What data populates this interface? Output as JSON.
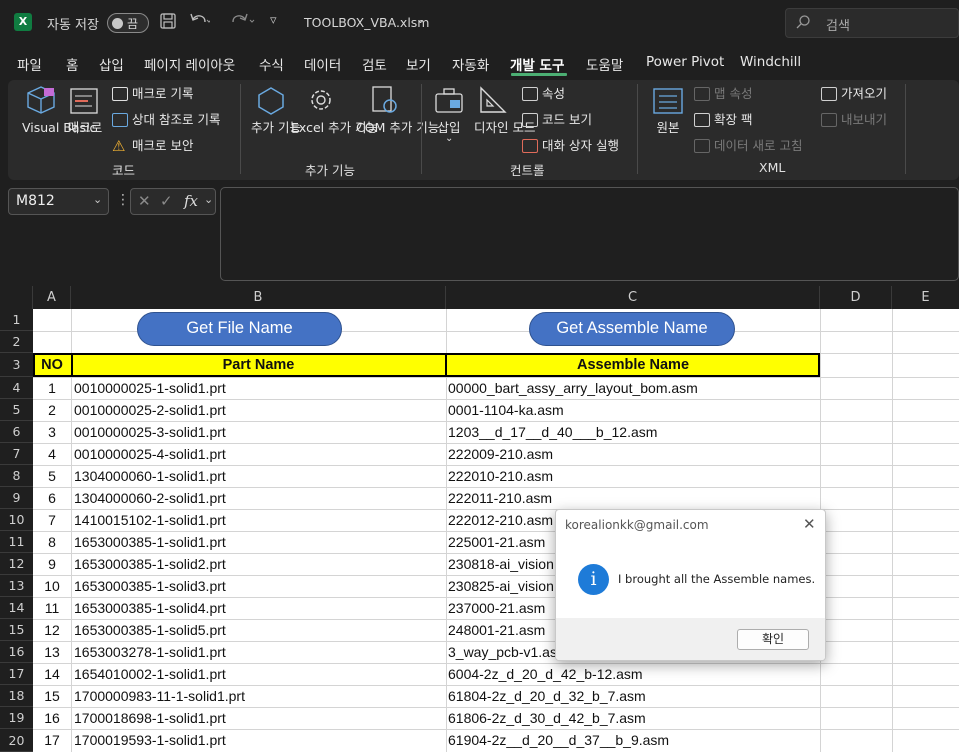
{
  "titlebar": {
    "autosave_label": "자동 저장",
    "autosave_state": "끔",
    "filename": "TOOLBOX_VBA.xlsm",
    "search_placeholder": "검색"
  },
  "tabs": [
    "파일",
    "홈",
    "삽입",
    "페이지 레이아웃",
    "수식",
    "데이터",
    "검토",
    "보기",
    "자동화",
    "개발 도구",
    "도움말",
    "Power Pivot",
    "Windchill"
  ],
  "active_tab": "개발 도구",
  "ribbon": {
    "code": {
      "visual_basic": "Visual Basic",
      "macros": "매크로",
      "record_macro": "매크로 기록",
      "relative_ref": "상대 참조로 기록",
      "macro_security": "매크로 보안",
      "group_label": "코드"
    },
    "addins": {
      "addins": "추가 기능",
      "excel_addins": "Excel 추가 기능",
      "com_addins": "COM 추가 기능",
      "group_label": "추가 기능"
    },
    "controls": {
      "insert": "삽입",
      "design_mode": "디자인 모드",
      "properties": "속성",
      "view_code": "코드 보기",
      "run_dialog": "대화 상자 실행",
      "group_label": "컨트롤"
    },
    "xml": {
      "source": "원본",
      "map_properties": "맵 속성",
      "expansion_packs": "확장 팩",
      "refresh_data": "데이터 새로 고침",
      "import": "가져오기",
      "export": "내보내기",
      "group_label": "XML"
    }
  },
  "formula_bar": {
    "name_box": "M812",
    "fx": "fx"
  },
  "sheet": {
    "columns": [
      "A",
      "B",
      "C",
      "D",
      "E"
    ],
    "row_numbers": [
      "1",
      "2",
      "3",
      "4",
      "5",
      "6",
      "7",
      "8",
      "9",
      "10",
      "11",
      "12",
      "13",
      "14",
      "15",
      "16",
      "17",
      "18",
      "19",
      "20"
    ],
    "button_file": "Get File Name",
    "button_assemble": "Get Assemble Name",
    "header": {
      "no": "NO",
      "part": "Part Name",
      "assemble": "Assemble Name"
    },
    "rows": [
      {
        "no": "1",
        "part": "0010000025-1-solid1.prt",
        "asm": "00000_bart_assy_arry_layout_bom.asm"
      },
      {
        "no": "2",
        "part": "0010000025-2-solid1.prt",
        "asm": "0001-1104-ka.asm"
      },
      {
        "no": "3",
        "part": "0010000025-3-solid1.prt",
        "asm": "1203__d_17__d_40___b_12.asm"
      },
      {
        "no": "4",
        "part": "0010000025-4-solid1.prt",
        "asm": "222009-210.asm"
      },
      {
        "no": "5",
        "part": "1304000060-1-solid1.prt",
        "asm": "222010-210.asm"
      },
      {
        "no": "6",
        "part": "1304000060-2-solid1.prt",
        "asm": "222011-210.asm"
      },
      {
        "no": "7",
        "part": "1410015102-1-solid1.prt",
        "asm": "222012-210.asm"
      },
      {
        "no": "8",
        "part": "1653000385-1-solid1.prt",
        "asm": "225001-21.asm"
      },
      {
        "no": "9",
        "part": "1653000385-1-solid2.prt",
        "asm": "230818-ai_vision"
      },
      {
        "no": "10",
        "part": "1653000385-1-solid3.prt",
        "asm": "230825-ai_vision"
      },
      {
        "no": "11",
        "part": "1653000385-1-solid4.prt",
        "asm": "237000-21.asm"
      },
      {
        "no": "12",
        "part": "1653000385-1-solid5.prt",
        "asm": "248001-21.asm"
      },
      {
        "no": "13",
        "part": "1653003278-1-solid1.prt",
        "asm": "3_way_pcb-v1.asm"
      },
      {
        "no": "14",
        "part": "1654010002-1-solid1.prt",
        "asm": "6004-2z_d_20_d_42_b-12.asm"
      },
      {
        "no": "15",
        "part": "1700000983-11-1-solid1.prt",
        "asm": "61804-2z_d_20_d_32_b_7.asm"
      },
      {
        "no": "16",
        "part": "1700018698-1-solid1.prt",
        "asm": "61806-2z_d_30_d_42_b_7.asm"
      },
      {
        "no": "17",
        "part": "1700019593-1-solid1.prt",
        "asm": "61904-2z__d_20__d_37__b_9.asm"
      }
    ]
  },
  "dialog": {
    "title": "korealionkk@gmail.com",
    "message": "I brought all the Assemble names.",
    "ok_label": "확인"
  },
  "colors": {
    "accent_green": "#4caf73",
    "button_blue": "#4472c4",
    "header_yellow": "#ffff00"
  }
}
